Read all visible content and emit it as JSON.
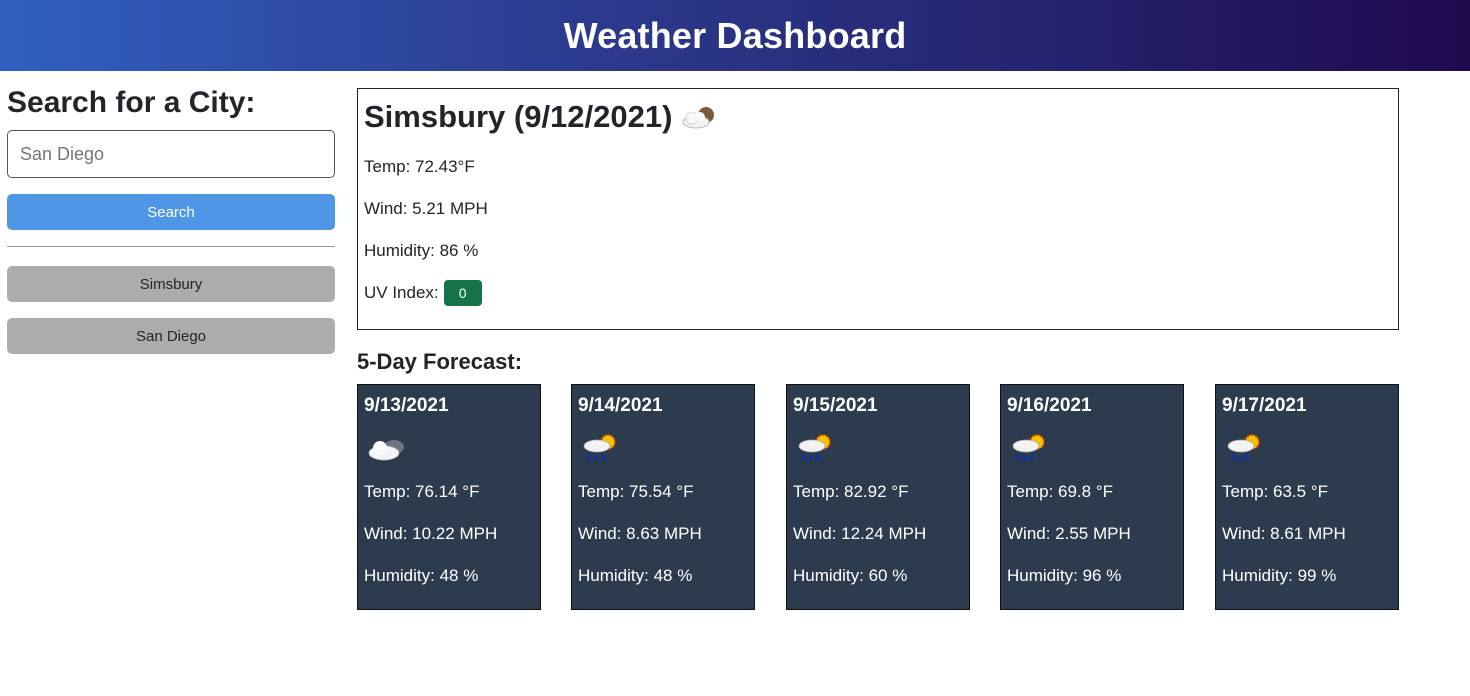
{
  "header": {
    "title": "Weather Dashboard"
  },
  "sidebar": {
    "heading": "Search for a City:",
    "search_placeholder": "San Diego",
    "search_button": "Search",
    "history": [
      "Simsbury",
      "San Diego"
    ]
  },
  "current": {
    "title": "Simsbury (9/12/2021)",
    "icon": "partly-cloudy-icon",
    "temp": "Temp: 72.43°F",
    "wind": "Wind: 5.21 MPH",
    "humidity": "Humidity: 86 %",
    "uv_label": "UV Index:",
    "uv_value": "0",
    "uv_color": "#157347"
  },
  "forecast": {
    "title": "5-Day Forecast:",
    "days": [
      {
        "date": "9/13/2021",
        "icon": "cloudy-icon",
        "temp": "Temp: 76.14 °F",
        "wind": "Wind: 10.22 MPH",
        "humidity": "Humidity: 48 %"
      },
      {
        "date": "9/14/2021",
        "icon": "rain-sun-icon",
        "temp": "Temp: 75.54 °F",
        "wind": "Wind: 8.63 MPH",
        "humidity": "Humidity: 48 %"
      },
      {
        "date": "9/15/2021",
        "icon": "rain-sun-icon",
        "temp": "Temp: 82.92 °F",
        "wind": "Wind: 12.24 MPH",
        "humidity": "Humidity: 60 %"
      },
      {
        "date": "9/16/2021",
        "icon": "rain-sun-icon",
        "temp": "Temp: 69.8 °F",
        "wind": "Wind: 2.55 MPH",
        "humidity": "Humidity: 96 %"
      },
      {
        "date": "9/17/2021",
        "icon": "rain-sun-icon",
        "temp": "Temp: 63.5 °F",
        "wind": "Wind: 8.61 MPH",
        "humidity": "Humidity: 99 %"
      }
    ]
  },
  "colors": {
    "search_button": "#4f96e6",
    "history_button": "#acacac",
    "card_background": "#2c3b4e"
  }
}
